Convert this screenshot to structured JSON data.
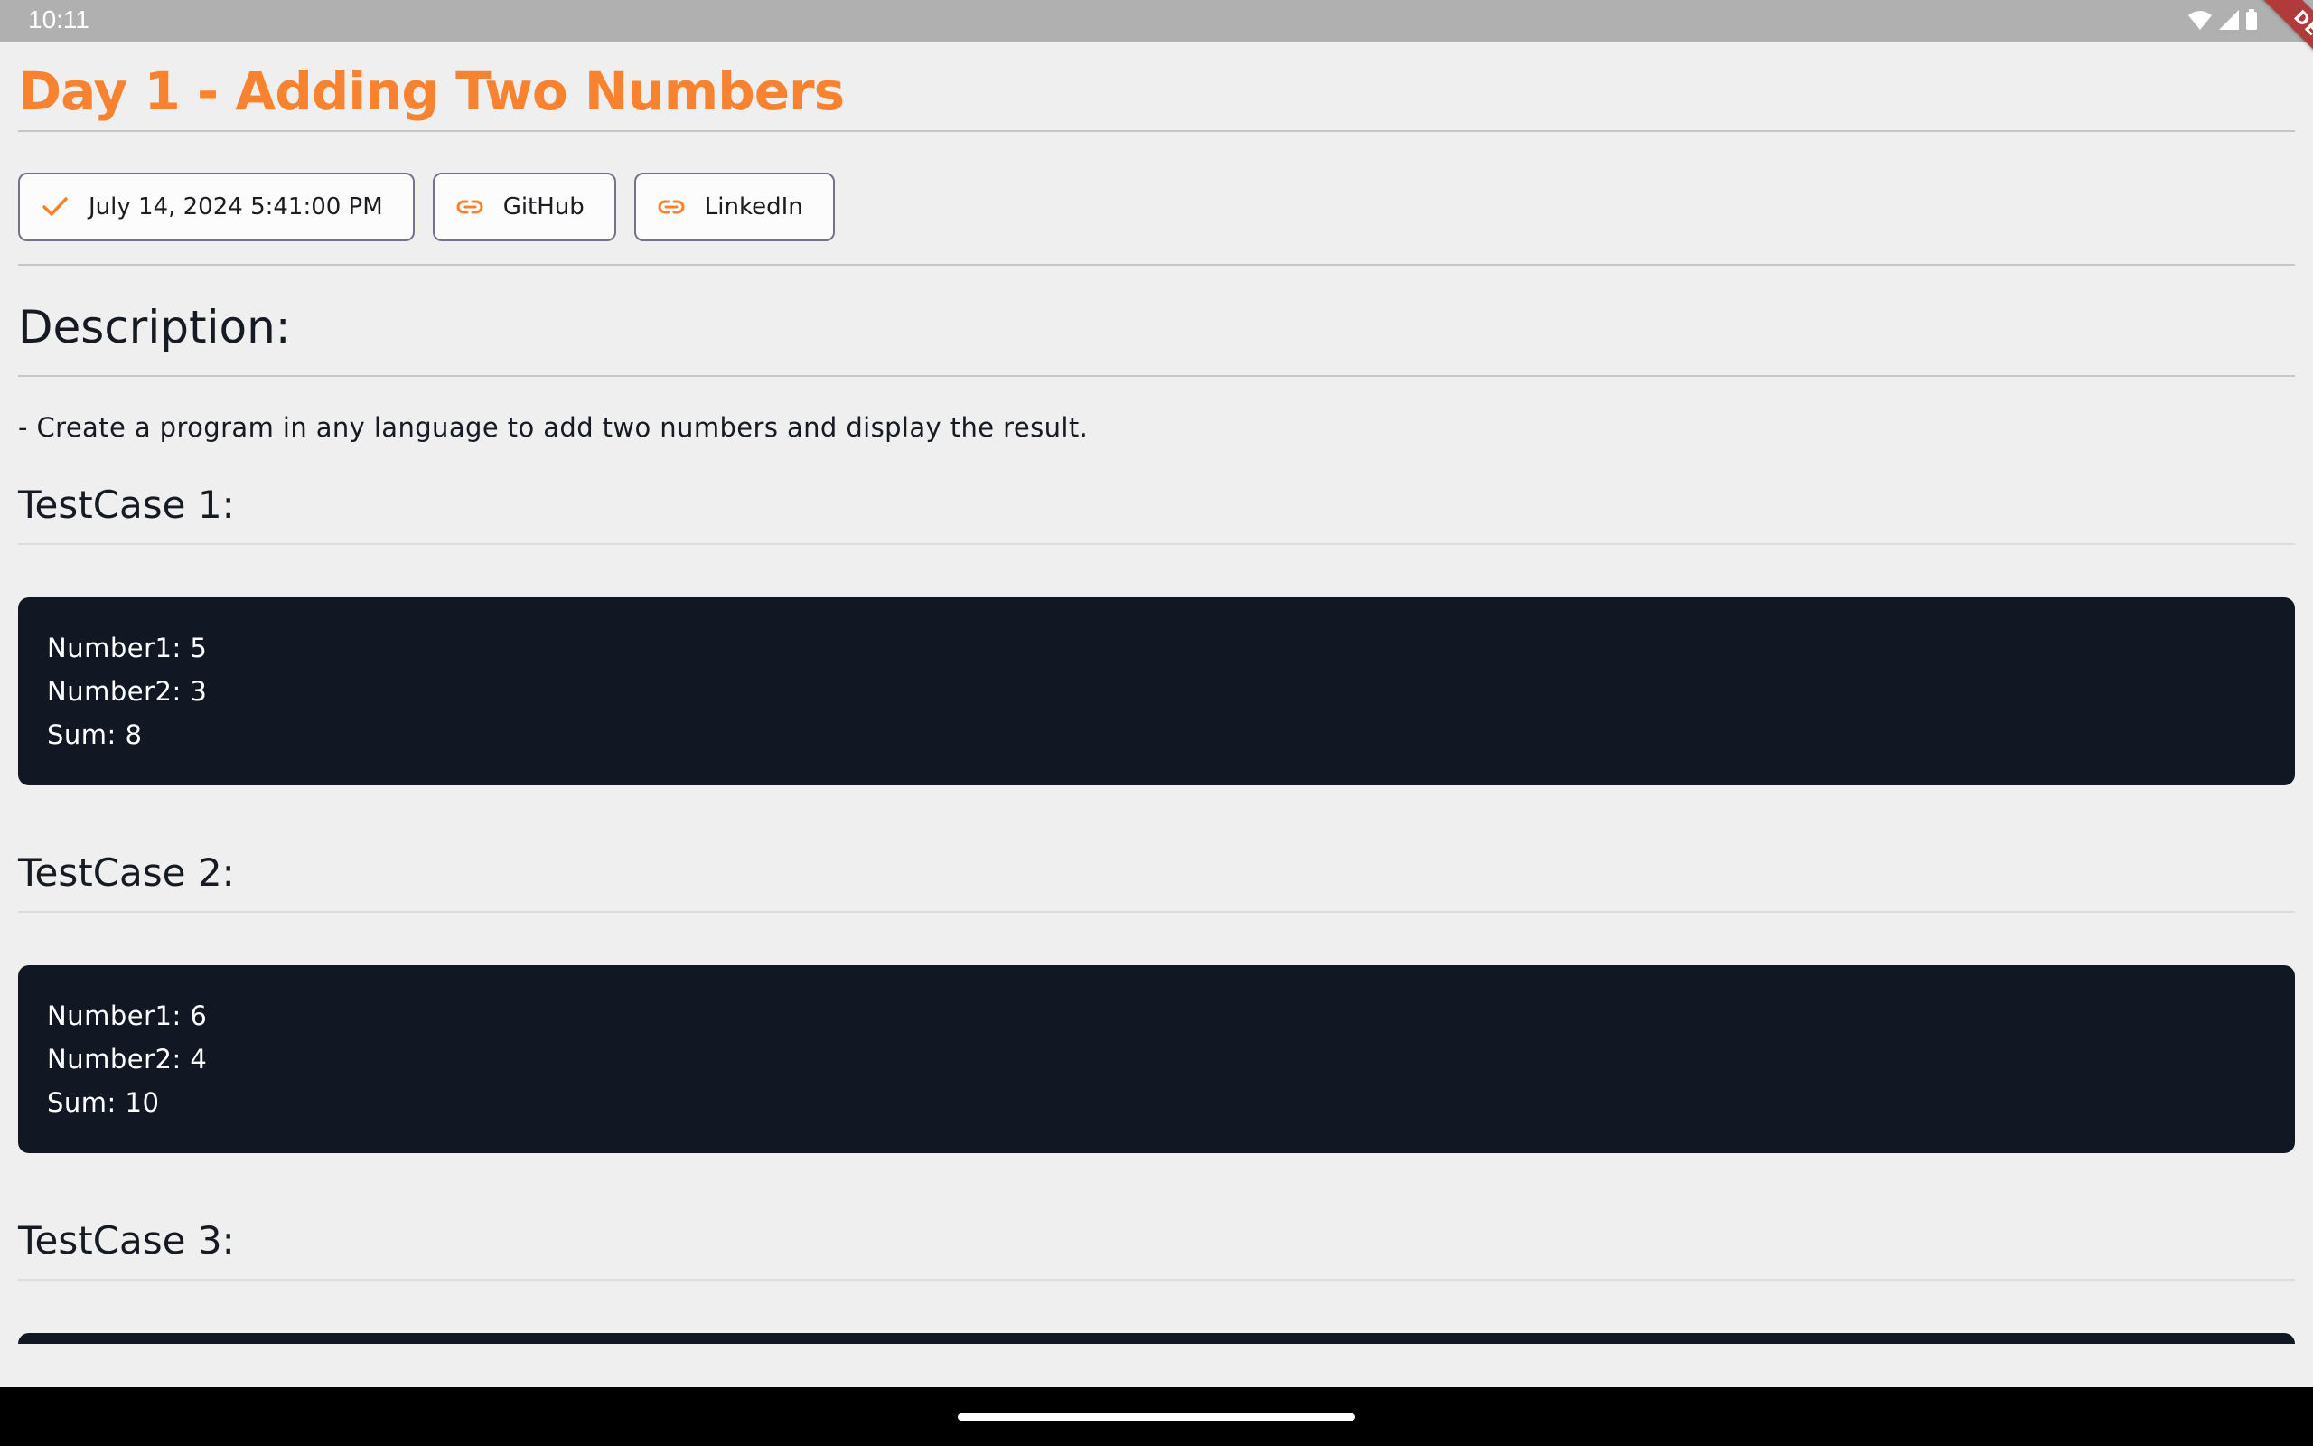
{
  "status_bar": {
    "time": "10:11",
    "icons": [
      "wifi-icon",
      "cell-signal-icon",
      "battery-icon"
    ]
  },
  "debug_banner": "DEBUG",
  "page": {
    "title": "Day 1 - Adding Two Numbers",
    "chips": [
      {
        "label": "July 14, 2024 5:41:00 PM",
        "icon": "check-icon"
      },
      {
        "label": "GitHub",
        "icon": "link-icon"
      },
      {
        "label": "LinkedIn",
        "icon": "link-icon"
      }
    ],
    "description_heading": "Description:",
    "description_text": "- Create a program in any language to add two numbers and display the result.",
    "testcases": [
      {
        "heading": "TestCase 1:",
        "lines": [
          "Number1: 5",
          "Number2: 3",
          "Sum: 8"
        ]
      },
      {
        "heading": "TestCase 2:",
        "lines": [
          "Number1: 6",
          "Number2: 4",
          "Sum: 10"
        ]
      },
      {
        "heading": "TestCase 3:"
      }
    ]
  },
  "colors": {
    "accent": "#f78330",
    "background": "#efefef",
    "code_background": "#111823",
    "status_bar": "#b0b0b0",
    "debug_ribbon": "#b13b3b"
  }
}
